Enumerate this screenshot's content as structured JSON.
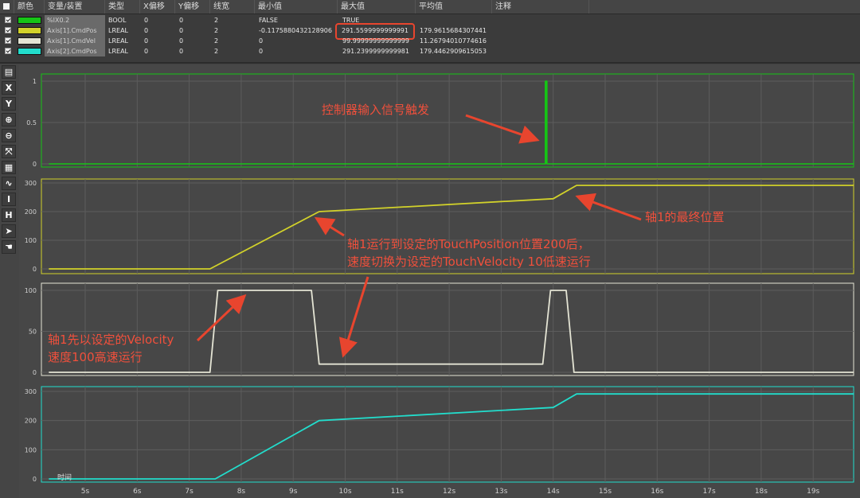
{
  "table": {
    "headers": {
      "color": "颜色",
      "variable": "变量/装置",
      "type": "类型",
      "xoffset": "X偏移",
      "yoffset": "Y偏移",
      "width": "线宽",
      "min": "最小值",
      "max": "最大值",
      "avg": "平均值",
      "note": "注释"
    },
    "rows": [
      {
        "color": "#16c516",
        "name": "%IX0.2",
        "type": "BOOL",
        "xoff": "0",
        "yoff": "0",
        "width": "2",
        "min": "FALSE",
        "max": "TRUE",
        "avg": ""
      },
      {
        "color": "#d2d22a",
        "name": "Axis[1].CmdPos",
        "type": "LREAL",
        "xoff": "0",
        "yoff": "0",
        "width": "2",
        "min": "-0.1175880432128906",
        "max": "291.5599999999991",
        "avg": "179.9615684307441"
      },
      {
        "color": "#e4e4d4",
        "name": "Axis[1].CmdVel",
        "type": "LREAL",
        "xoff": "0",
        "yoff": "0",
        "width": "2",
        "min": "0",
        "max": "99.99999999999999",
        "avg": "11.26794010774616"
      },
      {
        "color": "#22ddcc",
        "name": "Axis[2].CmdPos",
        "type": "LREAL",
        "xoff": "0",
        "yoff": "0",
        "width": "2",
        "min": "0",
        "max": "291.2399999999981",
        "avg": "179.4462909615053"
      }
    ]
  },
  "toolbar": [
    {
      "icon": "chart-view-icon",
      "glyph": "▤"
    },
    {
      "icon": "x-axis-icon",
      "glyph": "X"
    },
    {
      "icon": "y-axis-icon",
      "glyph": "Y"
    },
    {
      "icon": "zoom-in-icon",
      "glyph": "⊕"
    },
    {
      "icon": "zoom-out-icon",
      "glyph": "⊖"
    },
    {
      "icon": "fit-view-icon",
      "glyph": "⤧"
    },
    {
      "icon": "grid-icon",
      "glyph": "▦"
    },
    {
      "icon": "curve-icon",
      "glyph": "∿"
    },
    {
      "icon": "cursor-i-icon",
      "glyph": "I"
    },
    {
      "icon": "cursor-h-icon",
      "glyph": "H"
    },
    {
      "icon": "pointer-icon",
      "glyph": "➤"
    },
    {
      "icon": "hand-icon",
      "glyph": "☚"
    }
  ],
  "x_axis": {
    "label": "时间",
    "ticks": [
      "5s",
      "6s",
      "7s",
      "8s",
      "9s",
      "10s",
      "11s",
      "12s",
      "13s",
      "14s",
      "15s",
      "16s",
      "17s",
      "18s",
      "19s"
    ]
  },
  "chart_data": [
    {
      "type": "line",
      "series": [
        {
          "color": "#16c516",
          "x": [
            4.3,
            13.85,
            13.85,
            13.88,
            13.88,
            19.8
          ],
          "y": [
            0,
            0,
            1,
            1,
            0,
            0
          ]
        }
      ],
      "yticks": [
        "0",
        "0.5",
        "1"
      ],
      "ylim": [
        0,
        1
      ]
    },
    {
      "type": "line",
      "series": [
        {
          "color": "#d2d22a",
          "x": [
            4.3,
            7.4,
            9.5,
            14.0,
            14.45,
            19.8
          ],
          "y": [
            0,
            0,
            200,
            245,
            291.56,
            291.56
          ]
        }
      ],
      "yticks": [
        "0",
        "100",
        "200",
        "300"
      ],
      "ylim": [
        0,
        300
      ]
    },
    {
      "type": "line",
      "series": [
        {
          "color": "#e4e4d4",
          "x": [
            4.3,
            7.4,
            7.55,
            9.35,
            9.5,
            13.8,
            13.95,
            14.25,
            14.4,
            19.8
          ],
          "y": [
            0,
            0,
            100,
            100,
            10,
            10,
            100,
            100,
            0,
            0
          ]
        }
      ],
      "yticks": [
        "0",
        "50",
        "100"
      ],
      "ylim": [
        0,
        100
      ]
    },
    {
      "type": "line",
      "series": [
        {
          "color": "#22ddcc",
          "x": [
            4.3,
            7.5,
            9.5,
            14.0,
            14.45,
            19.8
          ],
          "y": [
            0,
            0,
            200,
            245,
            291.24,
            291.24
          ]
        }
      ],
      "yticks": [
        "0",
        "100",
        "200",
        "300"
      ],
      "ylim": [
        0,
        300
      ]
    }
  ],
  "annotations": {
    "trigger": "控制器输入信号触发",
    "final_pos": "轴1的最终位置",
    "touch_line1": "轴1运行到设定的TouchPosition位置200后，",
    "touch_line2": "速度切换为设定的TouchVelocity 10低速运行",
    "vel_line1": "轴1先以设定的Velocity",
    "vel_line2": "速度100高速运行"
  }
}
